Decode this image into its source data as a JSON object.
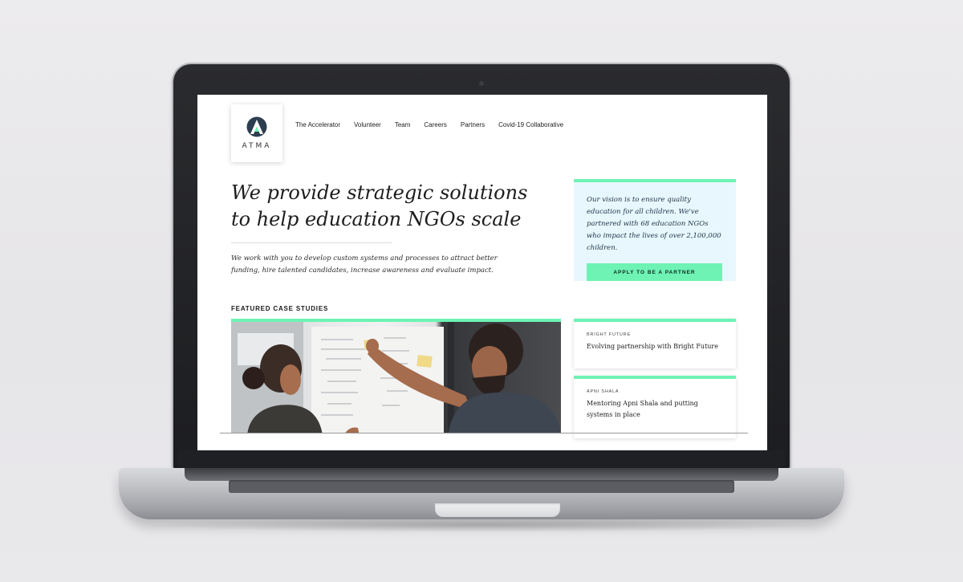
{
  "site": {
    "logo_text": "ATMA",
    "nav": [
      "The Accelerator",
      "Volunteer",
      "Team",
      "Careers",
      "Partners",
      "Covid-19 Collaborative"
    ],
    "headline_line1": "We provide strategic solutions",
    "headline_line2": "to help education NGOs scale",
    "subtext": "We work with you to develop custom systems and processes to attract better funding, hire talented candidates, increase awareness and evaluate impact.",
    "vision_text": "Our vision is to ensure quality education for all children. We've partnered with 68 education NGOs who impact the lives of over 2,100,000 children.",
    "apply_button": "APPLY TO BE A PARTNER",
    "featured_label": "FEATURED CASE STUDIES",
    "case_studies": [
      {
        "tag": "BRIGHT FUTURE",
        "title": "Evolving partnership with Bright Future"
      },
      {
        "tag": "APNI SHALA",
        "title": "Mentoring Apni Shala and putting systems in place"
      }
    ]
  },
  "colors": {
    "accent": "#6ef3b4",
    "vision_bg": "#e8f7fd",
    "logo_mark": "#2c3e50"
  },
  "icons": {
    "logo": "atma-a-mark-icon"
  }
}
